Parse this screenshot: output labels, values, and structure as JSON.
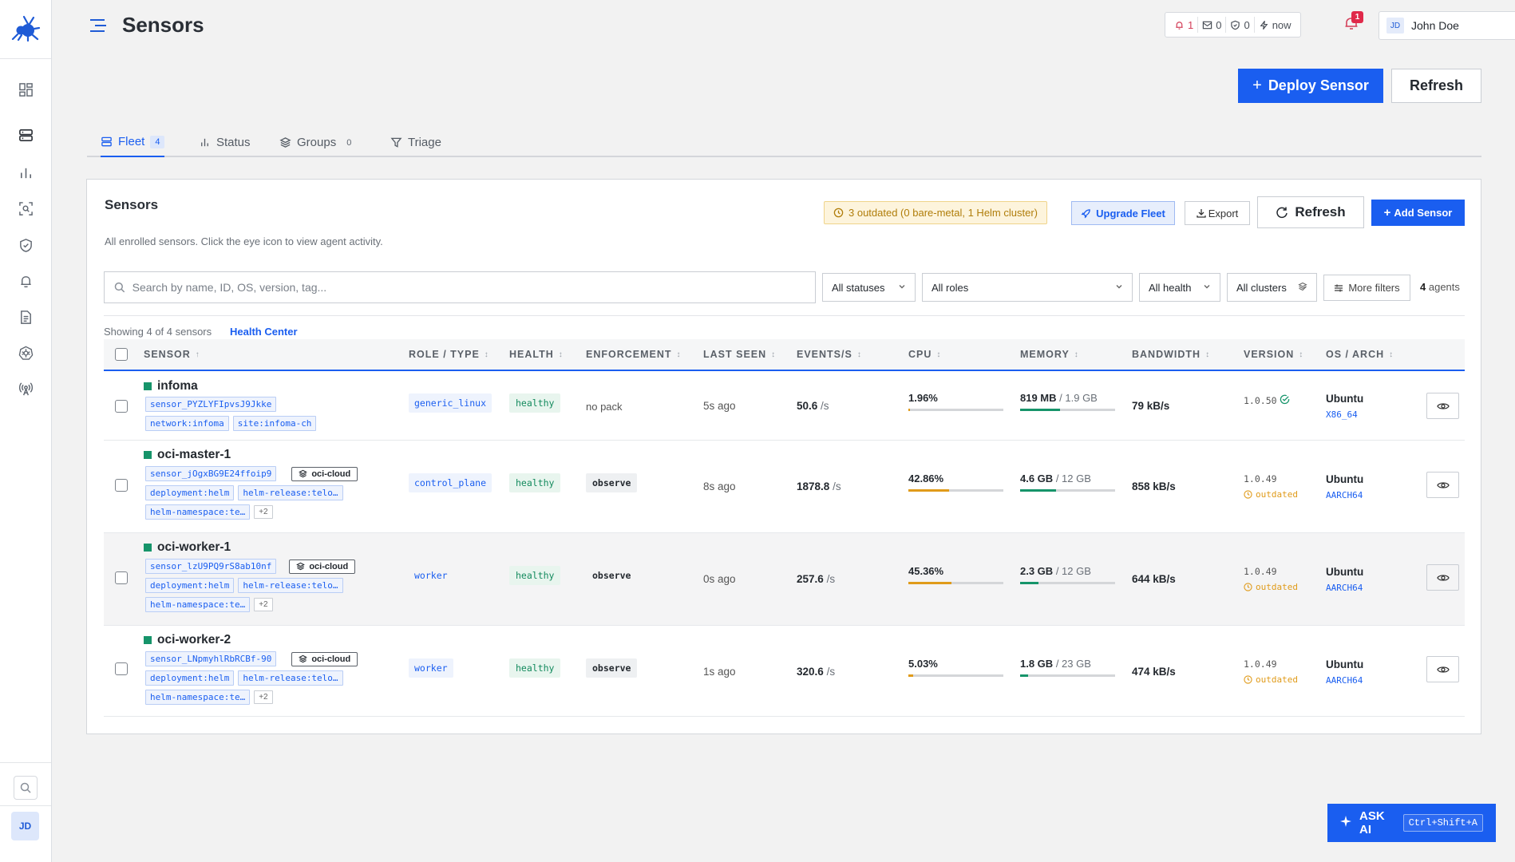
{
  "page": {
    "title": "Sensors"
  },
  "topbar": {
    "stats": [
      {
        "icon": "bell-alert-icon",
        "value": "1"
      },
      {
        "icon": "inbox-icon",
        "value": "0"
      },
      {
        "icon": "shield-icon",
        "value": "0"
      },
      {
        "icon": "bolt-icon",
        "value": "now"
      }
    ],
    "notification_count": "1",
    "user": {
      "initials": "JD",
      "name": "John Doe"
    }
  },
  "sidebar": {
    "items": [
      {
        "icon": "dashboard-icon"
      },
      {
        "icon": "servers-icon"
      },
      {
        "icon": "chart-icon"
      },
      {
        "icon": "scan-icon"
      },
      {
        "icon": "shield-icon"
      },
      {
        "icon": "bell-icon"
      },
      {
        "icon": "document-icon"
      },
      {
        "icon": "kubernetes-icon"
      },
      {
        "icon": "antenna-icon"
      }
    ],
    "avatar": "JD"
  },
  "actions": {
    "deploy": "Deploy Sensor",
    "refresh": "Refresh"
  },
  "tabs": [
    {
      "label": "Fleet",
      "count": "4",
      "icon": "servers-icon"
    },
    {
      "label": "Status",
      "icon": "bars-icon"
    },
    {
      "label": "Groups",
      "count": "0",
      "icon": "layers-icon"
    },
    {
      "label": "Triage",
      "icon": "filter-icon"
    }
  ],
  "card": {
    "title": "Sensors",
    "subtitle": "All enrolled sensors. Click the eye icon to view agent activity.",
    "warning": "3 outdated (0 bare-metal, 1 Helm cluster)",
    "upgrade": "Upgrade Fleet",
    "export": "Export",
    "refresh": "Refresh",
    "add": "Add Sensor"
  },
  "filters": {
    "search_placeholder": "Search by name, ID, OS, version, tag...",
    "status": "All statuses",
    "roles": "All roles",
    "health": "All health",
    "clusters": "All clusters",
    "more": "More filters",
    "agents_count": "4",
    "agents_label": "agents"
  },
  "table": {
    "showing": "Showing 4 of 4 sensors",
    "health_center": "Health Center",
    "columns": [
      "SENSOR",
      "ROLE / TYPE",
      "HEALTH",
      "ENFORCEMENT",
      "LAST SEEN",
      "EVENTS/S",
      "CPU",
      "MEMORY",
      "BANDWIDTH",
      "VERSION",
      "OS / ARCH"
    ],
    "rows": [
      {
        "name": "infoma",
        "id": "sensor_PYZLYFIpvsJ9Jkke",
        "tags": [
          "network:infoma",
          "site:infoma-ch"
        ],
        "role": "generic_linux",
        "health": "healthy",
        "enforcement": "no pack",
        "last_seen": "5s ago",
        "events": "50.6",
        "events_unit": "/s",
        "cpu": "1.96%",
        "cpu_pct": 1.96,
        "mem_used": "819 MB",
        "mem_total": "/ 1.9 GB",
        "mem_pct": 42,
        "bandwidth": "79 kB/s",
        "version": "1.0.50",
        "version_status": "",
        "os": "Ubuntu",
        "arch": "X86_64"
      },
      {
        "name": "oci-master-1",
        "id": "sensor_jOgxBG9E24ffoip9",
        "cloud": "oci-cloud",
        "tags": [
          "deployment:helm",
          "helm-release:telo…",
          "helm-namespace:te…"
        ],
        "more": "+2",
        "role": "control_plane",
        "health": "healthy",
        "enforcement": "observe",
        "last_seen": "8s ago",
        "events": "1878.8",
        "events_unit": "/s",
        "cpu": "42.86%",
        "cpu_pct": 42.86,
        "mem_used": "4.6 GB",
        "mem_total": "/ 12 GB",
        "mem_pct": 38,
        "bandwidth": "858 kB/s",
        "version": "1.0.49",
        "version_status": "outdated",
        "os": "Ubuntu",
        "arch": "AARCH64"
      },
      {
        "name": "oci-worker-1",
        "id": "sensor_lzU9PQ9rS8ab10nf",
        "cloud": "oci-cloud",
        "tags": [
          "deployment:helm",
          "helm-release:telo…",
          "helm-namespace:te…"
        ],
        "more": "+2",
        "role": "worker",
        "health": "healthy",
        "enforcement": "observe",
        "last_seen": "0s ago",
        "events": "257.6",
        "events_unit": "/s",
        "cpu": "45.36%",
        "cpu_pct": 45.36,
        "mem_used": "2.3 GB",
        "mem_total": "/ 12 GB",
        "mem_pct": 19,
        "bandwidth": "644 kB/s",
        "version": "1.0.49",
        "version_status": "outdated",
        "os": "Ubuntu",
        "arch": "AARCH64"
      },
      {
        "name": "oci-worker-2",
        "id": "sensor_LNpmyhlRbRCBf-90",
        "cloud": "oci-cloud",
        "tags": [
          "deployment:helm",
          "helm-release:telo…",
          "helm-namespace:te…"
        ],
        "more": "+2",
        "role": "worker",
        "health": "healthy",
        "enforcement": "observe",
        "last_seen": "1s ago",
        "events": "320.6",
        "events_unit": "/s",
        "cpu": "5.03%",
        "cpu_pct": 5.03,
        "mem_used": "1.8 GB",
        "mem_total": "/ 23 GB",
        "mem_pct": 8,
        "bandwidth": "474 kB/s",
        "version": "1.0.49",
        "version_status": "outdated",
        "os": "Ubuntu",
        "arch": "AARCH64"
      }
    ]
  },
  "askai": {
    "label": "ASK AI",
    "shortcut": "Ctrl+Shift+A"
  },
  "colors": {
    "accent": "#1a5ef0",
    "healthy": "#16946a",
    "cpu_bar": "#e09b1a",
    "mem_bar": "#16946a",
    "alert": "#d4405a"
  }
}
